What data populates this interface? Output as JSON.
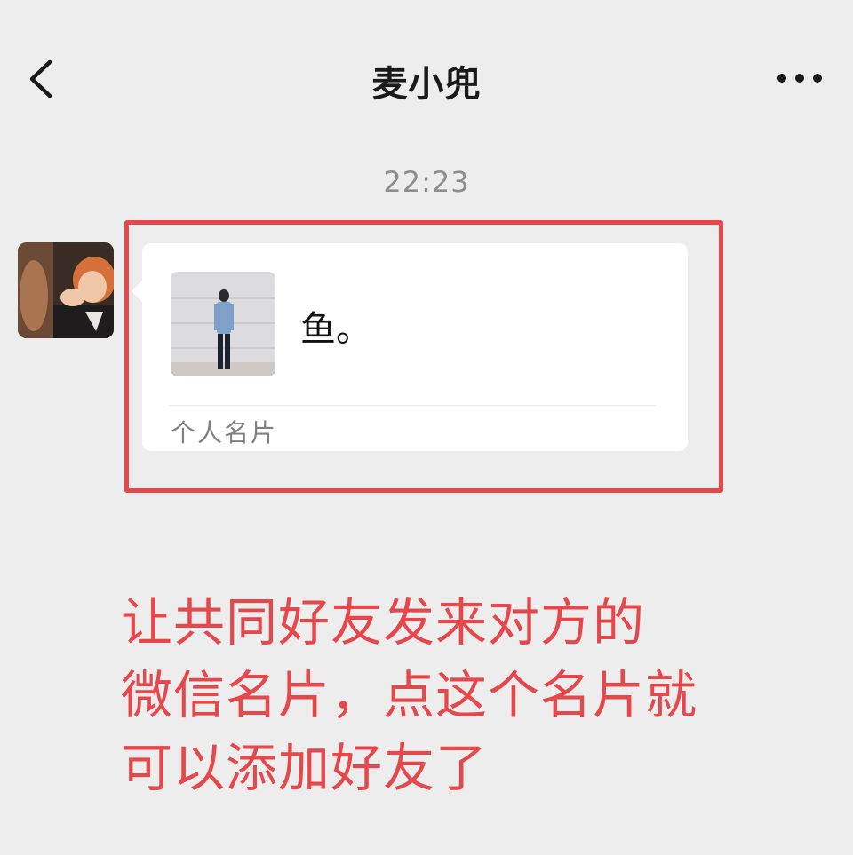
{
  "header": {
    "title": "麦小兜",
    "back_icon": "chevron-left-icon",
    "more_icon": "more-dots-icon"
  },
  "chat": {
    "timestamp": "22:23",
    "message": {
      "card": {
        "name": "鱼。",
        "type_label": "个人名片"
      }
    }
  },
  "annotation": {
    "lines": [
      "让共同好友发来对方的",
      "微信名片，点这个名片就",
      "可以添加好友了"
    ]
  },
  "colors": {
    "background": "#ededed",
    "bubble": "#ffffff",
    "highlight_red": "#e5474b",
    "timestamp_gray": "#8d8d8d"
  }
}
